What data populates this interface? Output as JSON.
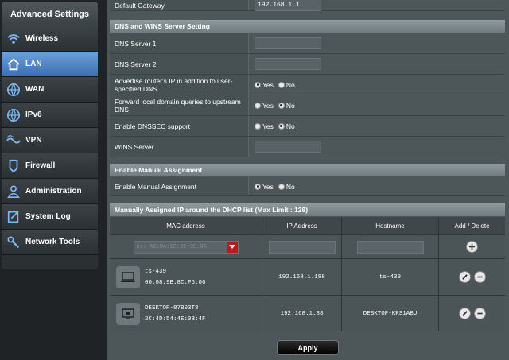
{
  "sidebar": {
    "title": "Advanced Settings",
    "items": [
      {
        "label": "Wireless",
        "icon": "wifi-icon"
      },
      {
        "label": "LAN",
        "icon": "home-icon",
        "active": true
      },
      {
        "label": "WAN",
        "icon": "globe-icon"
      },
      {
        "label": "IPv6",
        "icon": "globe-icon"
      },
      {
        "label": "VPN",
        "icon": "vpn-icon"
      },
      {
        "label": "Firewall",
        "icon": "shield-icon"
      },
      {
        "label": "Administration",
        "icon": "user-icon"
      },
      {
        "label": "System Log",
        "icon": "log-icon"
      },
      {
        "label": "Network Tools",
        "icon": "tools-icon"
      }
    ]
  },
  "gateway": {
    "label": "Default Gateway",
    "value": "192.168.1.1"
  },
  "dns_section": {
    "title": "DNS and WINS Server Setting",
    "dns1_label": "DNS Server 1",
    "dns1_value": "",
    "dns2_label": "DNS Server 2",
    "dns2_value": "",
    "advertise_label": "Advertise router's IP in addition to user-specified DNS",
    "forward_label": "Forward local domain queries to upstream DNS",
    "dnssec_label": "Enable DNSSEC support",
    "wins_label": "WINS Server",
    "wins_value": "",
    "yes": "Yes",
    "no": "No"
  },
  "manual_section": {
    "title": "Enable Manual Assignment",
    "label": "Enable Manual Assignment",
    "yes": "Yes",
    "no": "No"
  },
  "dhcp_list": {
    "title": "Manually Assigned IP around the DHCP list (Max Limit : 128)",
    "columns": [
      "MAC address",
      "IP Address",
      "Hostname",
      "Add / Delete"
    ],
    "mac_placeholder": "ex: AC:DA:1E:9E:9E:8A",
    "rows": [
      {
        "name": "ts-439",
        "mac": "00:08:9B:8C:F6:00",
        "ip": "192.168.1.188",
        "hostname": "ts-439"
      },
      {
        "name": "DESKTOP-87B03T8",
        "mac": "2C:4D:54:4E:0B:4F",
        "ip": "192.168.1.88",
        "hostname": "DESKTOP-KRS1ABU"
      }
    ]
  },
  "apply_label": "Apply",
  "colors": {
    "active": "#4a7dc0",
    "panel": "#4d5659",
    "header": "#7f8a8e",
    "dropdown": "#b51c1c"
  }
}
